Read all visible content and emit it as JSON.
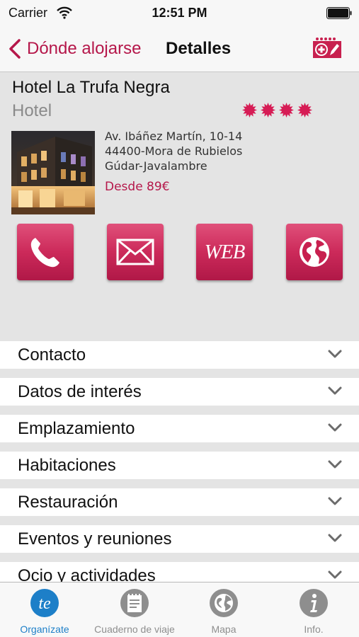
{
  "status_bar": {
    "carrier": "Carrier",
    "time": "12:51 PM"
  },
  "nav": {
    "back_label": "Dónde alojarse",
    "title": "Detalles",
    "add_icon": "add-to-trip-icon"
  },
  "hotel": {
    "name": "Hotel La Trufa Negra",
    "type": "Hotel",
    "stars": 4,
    "address_line1": "Av. Ibáñez Martín, 10-14",
    "address_line2": "44400-Mora de Rubielos",
    "address_line3": "Gúdar-Javalambre",
    "price": "Desde 89€"
  },
  "actions": {
    "call_icon": "phone-icon",
    "email_icon": "envelope-icon",
    "web_label": "WEB",
    "globe_icon": "globe-icon"
  },
  "sections": [
    {
      "label": "Contacto"
    },
    {
      "label": "Datos de interés"
    },
    {
      "label": "Emplazamiento"
    },
    {
      "label": "Habitaciones"
    },
    {
      "label": "Restauración"
    },
    {
      "label": "Eventos y reuniones"
    },
    {
      "label": "Ocio y actividades"
    }
  ],
  "tabs": [
    {
      "label": "Organízate",
      "active": true
    },
    {
      "label": "Cuaderno de viaje",
      "active": false
    },
    {
      "label": "Mapa",
      "active": false
    },
    {
      "label": "Info.",
      "active": false
    }
  ],
  "colors": {
    "accent": "#b5174a",
    "tab_active": "#1d7fc8",
    "tab_inactive": "#8e8e8e",
    "background": "#e4e4e4"
  }
}
